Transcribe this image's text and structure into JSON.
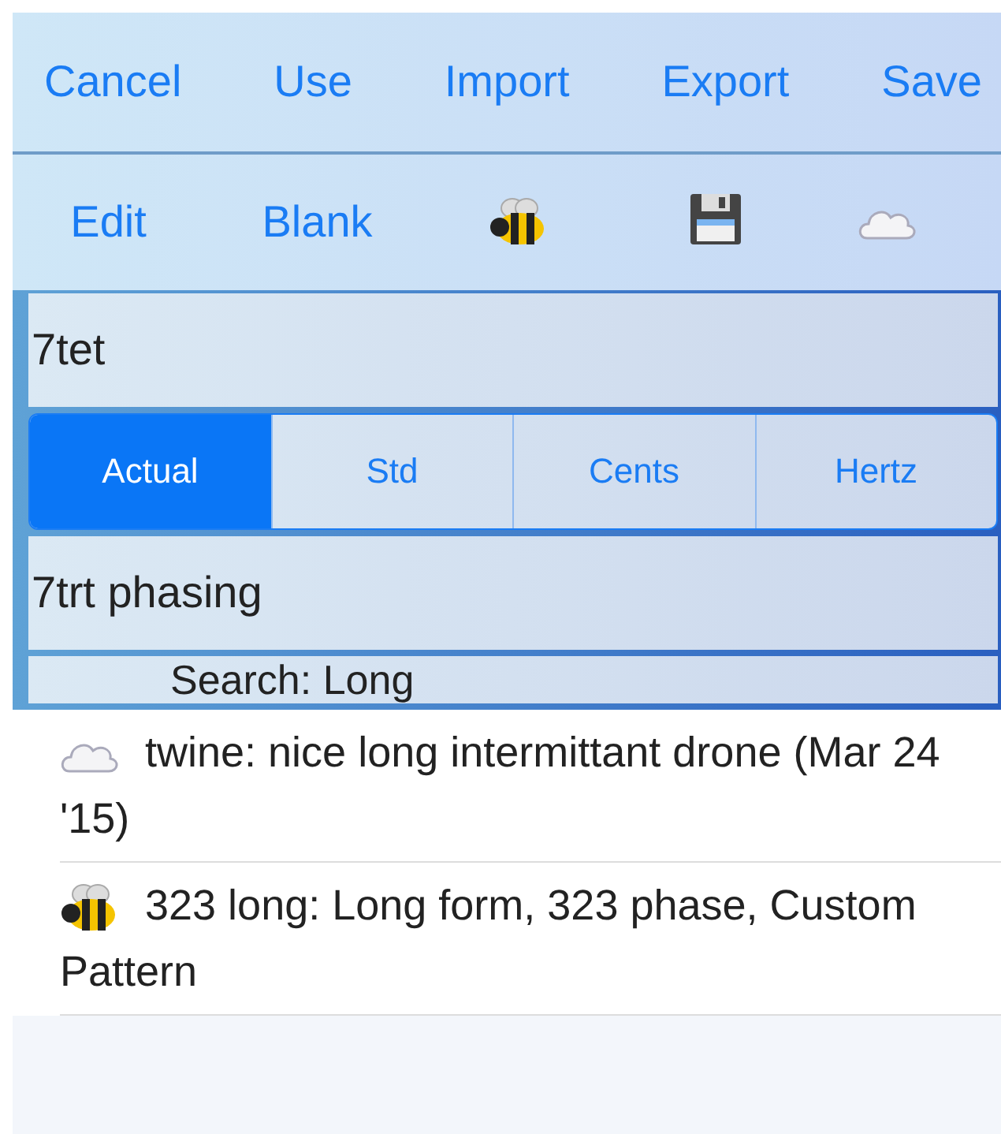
{
  "nav_bar": {
    "buttons": [
      "Cancel",
      "Use",
      "Import",
      "Export",
      "Save"
    ]
  },
  "toolbar": {
    "items": [
      {
        "kind": "text",
        "label": "Edit"
      },
      {
        "kind": "text",
        "label": "Blank"
      },
      {
        "kind": "bee"
      },
      {
        "kind": "floppy"
      },
      {
        "kind": "cloud"
      }
    ]
  },
  "name_field": {
    "value": "7tet"
  },
  "segments": [
    {
      "label": "Actual",
      "selected": true
    },
    {
      "label": "Std",
      "selected": false
    },
    {
      "label": "Cents",
      "selected": false
    },
    {
      "label": "Hertz",
      "selected": false
    }
  ],
  "description_field": {
    "value": "7trt phasing"
  },
  "search": {
    "value": "Search: Long"
  },
  "results": [
    {
      "kind": "cloud",
      "text": "twine: nice long intermittant drone (Mar 24 '15)"
    },
    {
      "kind": "bee",
      "text": "323 long: Long form, 323 phase, Custom Pattern"
    }
  ]
}
